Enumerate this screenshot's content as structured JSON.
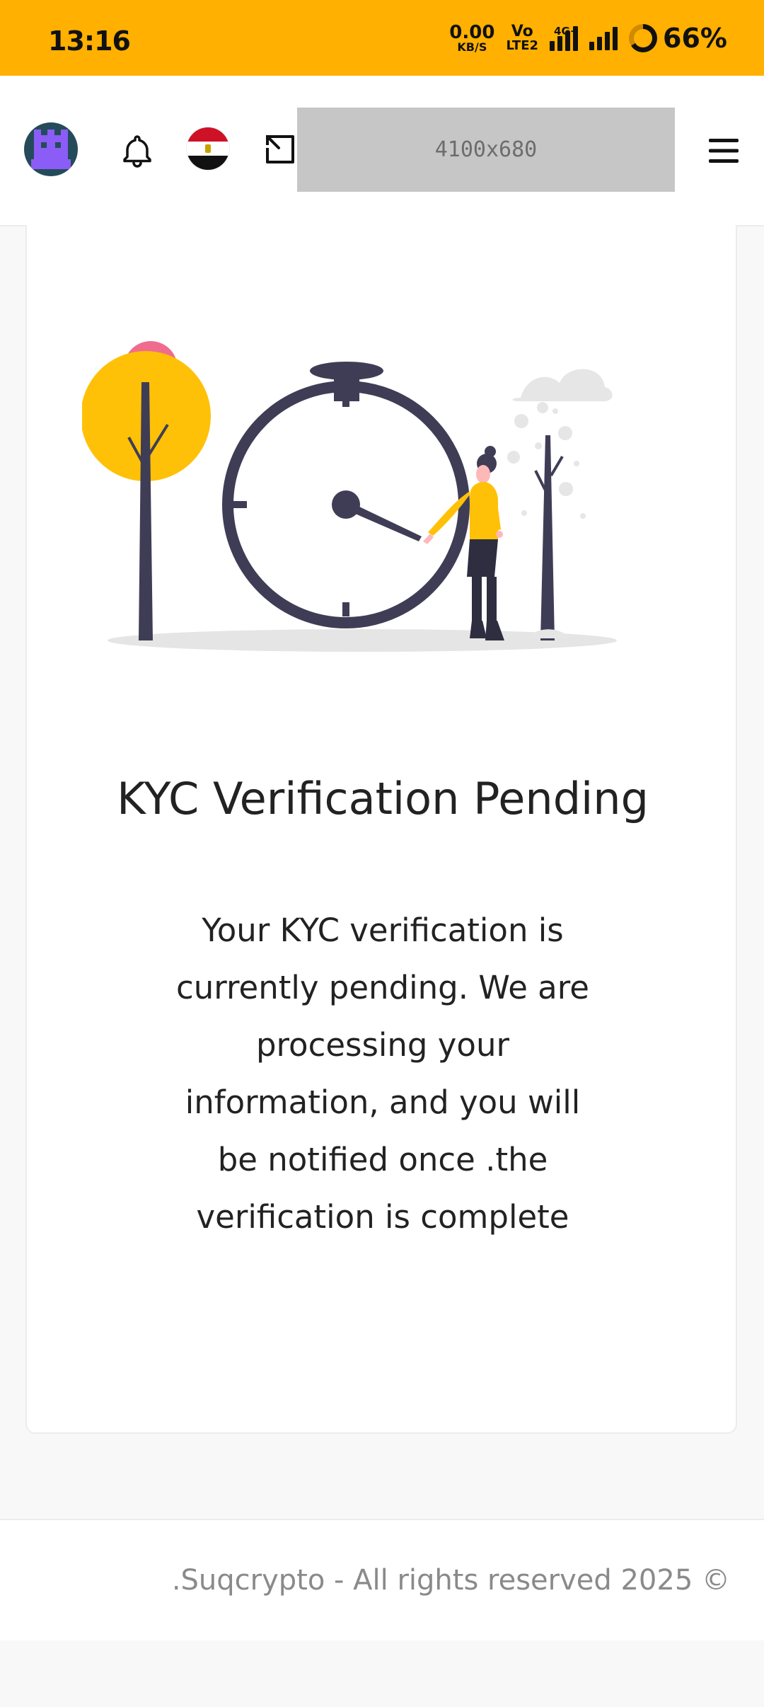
{
  "status_bar": {
    "time": "13:16",
    "net_speed_value": "0.00",
    "net_speed_unit": "KB/S",
    "volte_top": "Vo",
    "volte_bottom": "LTE2",
    "network_type": "4G+",
    "battery_text": "66%",
    "battery_level": 0.66
  },
  "header": {
    "icons": [
      "avatar",
      "bell-icon",
      "egypt-flag",
      "expand-icon",
      "menu-icon"
    ],
    "placeholder_text": "4100x680"
  },
  "main": {
    "title": "KYC Verification Pending",
    "message": "Your KYC verification is currently pending. We are processing your information, and you will be notified once .the verification is complete",
    "illustration_name": "pending-clock-illustration"
  },
  "footer": {
    "text": ".Suqcrypto - All rights reserved 2025 ©"
  },
  "colors": {
    "status_bar": "#ffb000",
    "accent_yellow": "#ffc107",
    "accent_pink": "#f06c8e",
    "dark_navy": "#3f3d56",
    "avatar_bg": "#244b5a",
    "avatar_fg": "#8b5cf6"
  }
}
